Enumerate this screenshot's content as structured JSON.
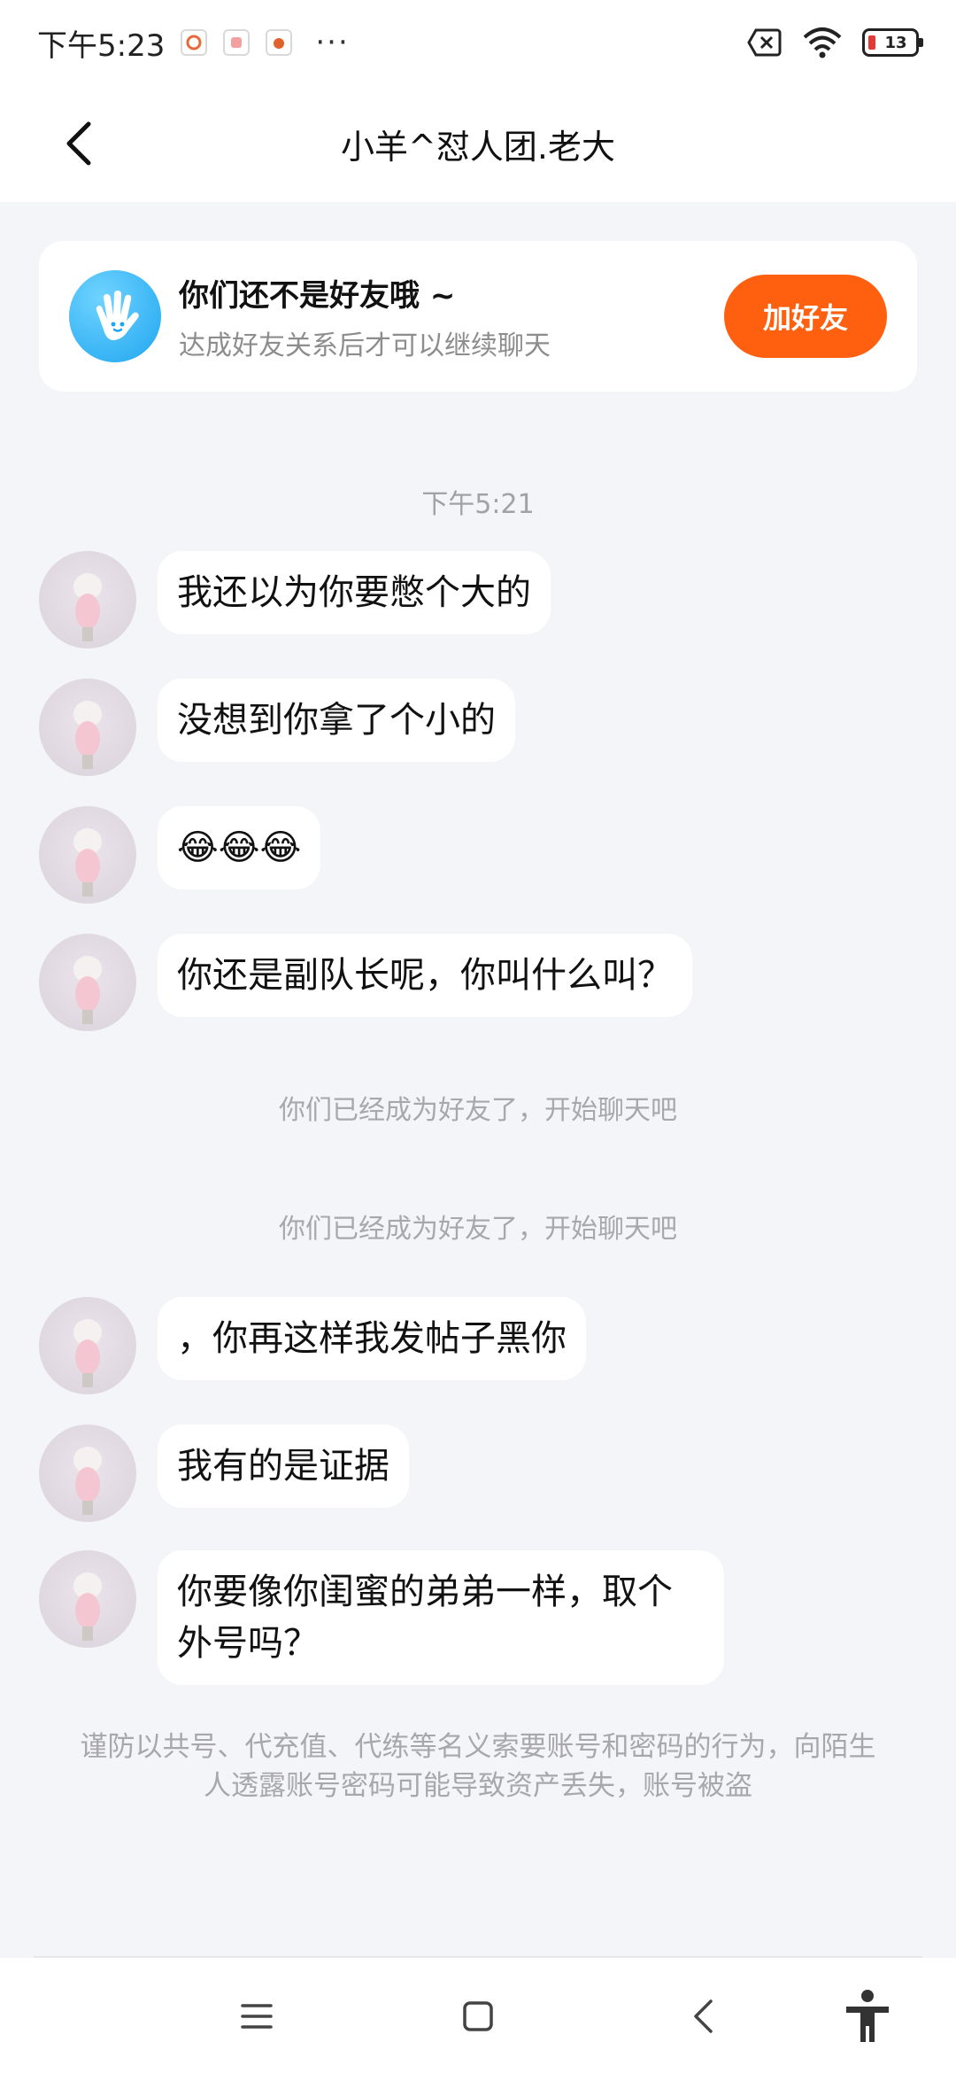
{
  "status_bar": {
    "time": "下午5:23",
    "more": "···",
    "battery": "13"
  },
  "header": {
    "title": "小羊^怼人团.老大"
  },
  "friend_card": {
    "title": "你们还不是好友哦 ~",
    "subtitle": "达成好友关系后才可以继续聊天",
    "add_button": "加好友"
  },
  "chat": {
    "timestamp": "下午5:21",
    "messages_a": [
      "我还以为你要憋个大的",
      "没想到你拿了个小的",
      "😂😂😂",
      "你还是副队长呢，你叫什么叫？"
    ],
    "system_1": "你们已经成为好友了，开始聊天吧",
    "system_2": "你们已经成为好友了，开始聊天吧",
    "messages_b": [
      "，你再这样我发帖子黑你",
      "我有的是证据",
      "你要像你闺蜜的弟弟一样，取个外号吗？"
    ]
  },
  "notice": "谨防以共号、代充值、代练等名义索要账号和密码的行为，向陌生人透露账号密码可能导致资产丢失，账号被盗",
  "colors": {
    "accent": "#ff6010",
    "background": "#f4f5f8",
    "bubble": "#ffffff"
  },
  "icons": {
    "back": "chevron-left-icon",
    "wave": "waving-hand-icon",
    "nav_menu": "menu-icon",
    "nav_home": "home-square-icon",
    "nav_back": "back-chevron-icon",
    "nav_accessibility": "accessibility-icon"
  }
}
